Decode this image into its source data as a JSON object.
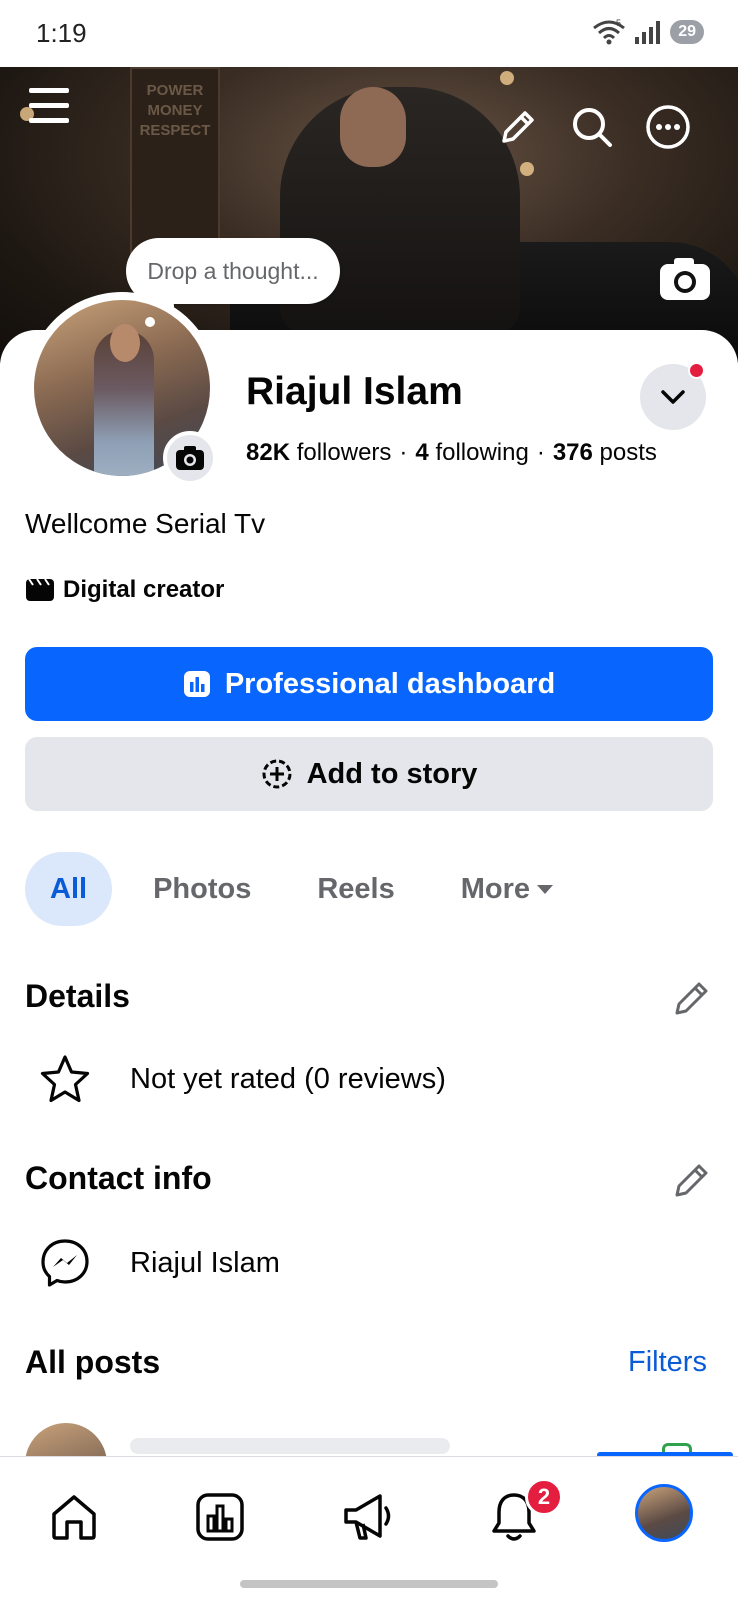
{
  "status_bar": {
    "time": "1:19",
    "battery": "29",
    "network_label": "5"
  },
  "cover": {
    "sign_text": "POWER MONEY RESPECT"
  },
  "profile": {
    "thought_placeholder": "Drop a thought...",
    "name": "Riajul Islam",
    "followers_count": "82K",
    "followers_label": "followers",
    "following_count": "4",
    "following_label": "following",
    "posts_count": "376",
    "posts_label": "posts",
    "bio": "Wellcome Serial Tv",
    "category": "Digital creator"
  },
  "buttons": {
    "dashboard": "Professional dashboard",
    "add_story": "Add to story"
  },
  "tabs": {
    "all": "All",
    "photos": "Photos",
    "reels": "Reels",
    "more": "More"
  },
  "details": {
    "title": "Details",
    "rating": "Not yet rated (0 reviews)"
  },
  "contact": {
    "title": "Contact info",
    "messenger_name": "Riajul Islam"
  },
  "posts": {
    "title": "All posts",
    "filters": "Filters"
  },
  "bottom_nav": {
    "notification_count": "2"
  },
  "colors": {
    "accent": "#0866ff",
    "badge": "#e41e3f",
    "tab_active_bg": "#dbe8fb"
  }
}
